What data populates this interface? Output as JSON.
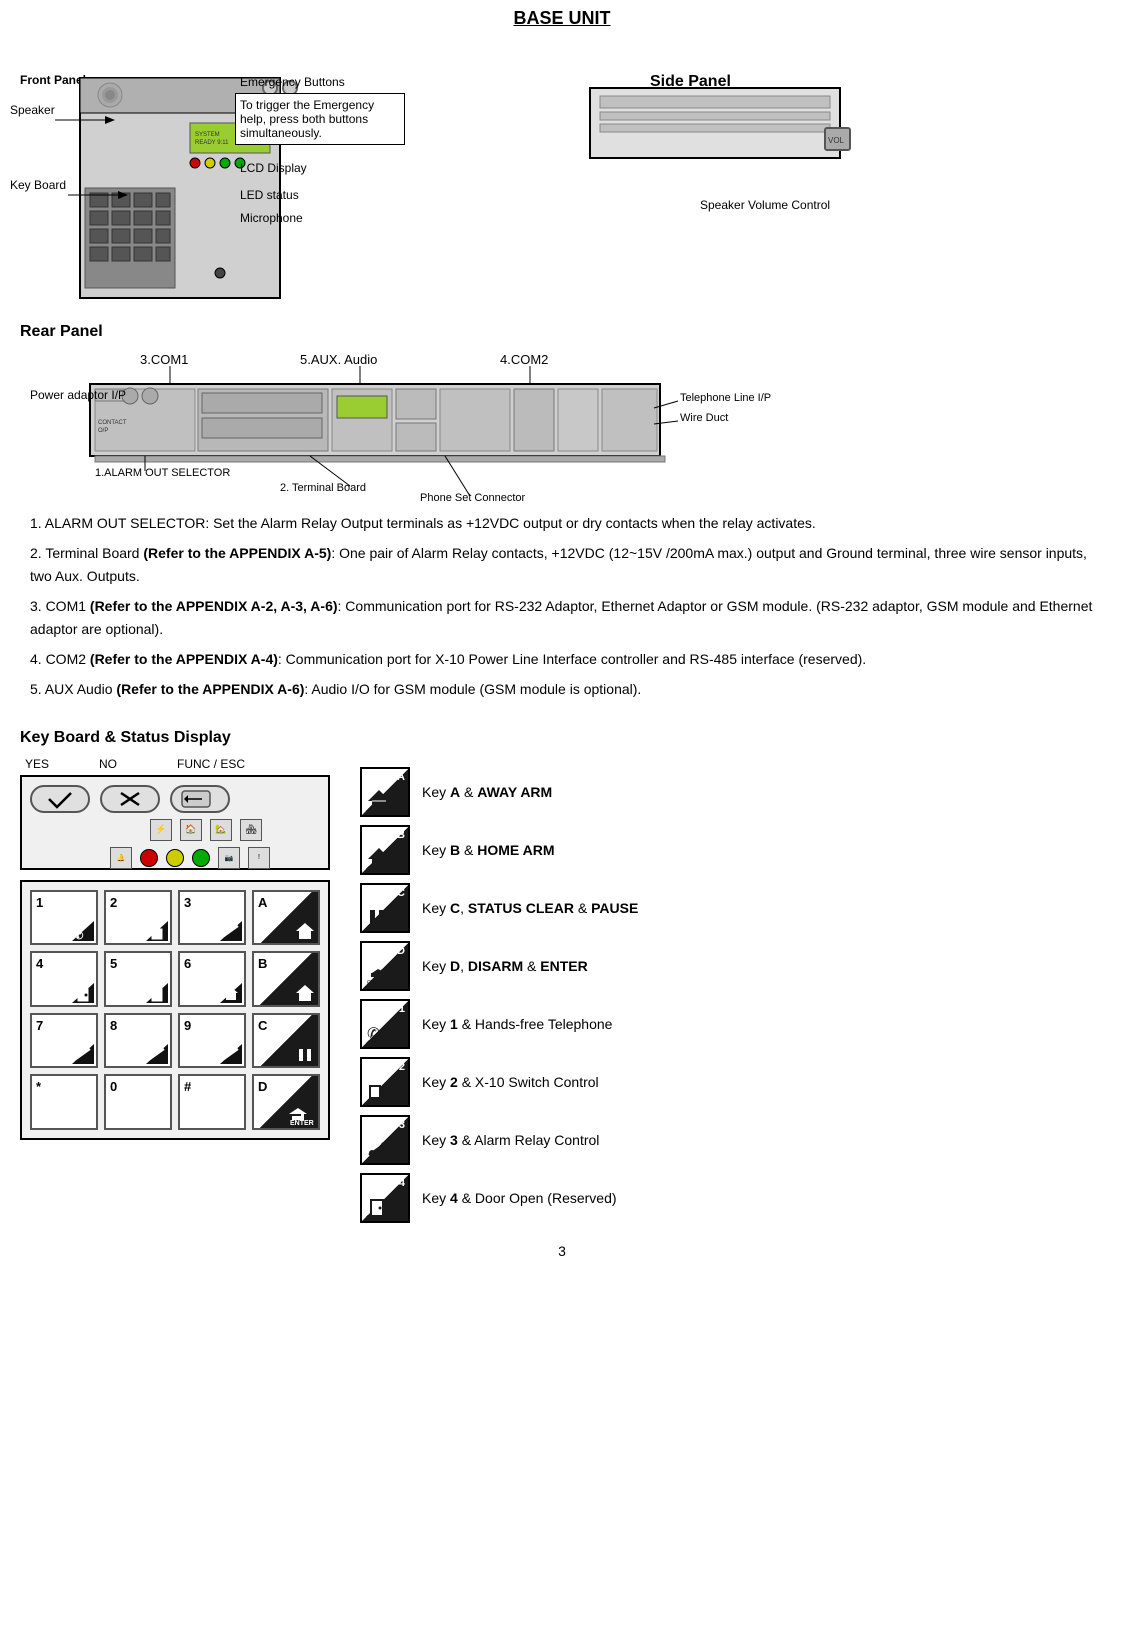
{
  "title": "BASE UNIT",
  "front_panel": {
    "label": "Front Panel",
    "side_panel_label": "Side Panel",
    "speaker_label": "Speaker",
    "key_board_label": "Key Board",
    "emergency_buttons_label": "Emergency Buttons",
    "emergency_desc": "To trigger the Emergency help, press both buttons simultaneously.",
    "lcd_label": "LCD Display",
    "led_label": "LED status",
    "mic_label": "Microphone",
    "speaker_volume_label": "Speaker Volume Control"
  },
  "rear_panel": {
    "label": "Rear Panel",
    "com1_label": "3.COM1",
    "aux_label": "5.AUX. Audio",
    "com2_label": "4.COM2",
    "alarm_label": "1.ALARM OUT SELECTOR",
    "terminal_label": "2. Terminal Board",
    "phone_connector_label": "Phone Set Connector",
    "telephone_label": "Telephone Line I/P",
    "wire_duct_label": "Wire Duct",
    "power_label": "Power adaptor I/P"
  },
  "descriptions": [
    {
      "id": 1,
      "text": "ALARM OUT SELECTOR: Set the Alarm Relay Output terminals as +12VDC output or dry contacts when the relay activates."
    },
    {
      "id": 2,
      "text": "Terminal Board ",
      "bold": "(Refer to the APPENDIX A-5)",
      "rest": ": One pair of Alarm Relay contacts, +12VDC (12~15V /200mA max.) output and Ground terminal, three wire sensor inputs, two Aux. Outputs."
    },
    {
      "id": 3,
      "text": "COM1 ",
      "bold": "(Refer to the APPENDIX A-2, A-3, A-6)",
      "rest": ": Communication port for RS-232 Adaptor, Ethernet Adaptor or GSM module. (RS-232 adaptor, GSM module and Ethernet adaptor are optional)."
    },
    {
      "id": 4,
      "text": "COM2 ",
      "bold": "(Refer to the APPENDIX A-4)",
      "rest": ": Communication port for X-10 Power Line Interface controller and RS-485 interface (reserved)."
    },
    {
      "id": 5,
      "text": "AUX Audio ",
      "bold": "(Refer to the APPENDIX A-6)",
      "rest": ": Audio I/O for GSM module (GSM module is optional)."
    }
  ],
  "keyboard_section": {
    "title": "Key Board & Status Display",
    "yes_label": "YES",
    "no_label": "NO",
    "func_esc_label": "FUNC / ESC",
    "keys": [
      {
        "num": "1",
        "symbol": "phone"
      },
      {
        "num": "2",
        "symbol": "box"
      },
      {
        "num": "3",
        "symbol": "slash"
      },
      {
        "num": "A",
        "symbol": "house-arm"
      },
      {
        "num": "4",
        "symbol": "box-key"
      },
      {
        "num": "5",
        "symbol": "box-key"
      },
      {
        "num": "6",
        "symbol": "house"
      },
      {
        "num": "B",
        "symbol": "home"
      },
      {
        "num": "7",
        "symbol": "slash"
      },
      {
        "num": "8",
        "symbol": "slash"
      },
      {
        "num": "9",
        "symbol": "slash"
      },
      {
        "num": "C",
        "symbol": "pause"
      },
      {
        "num": "*",
        "symbol": ""
      },
      {
        "num": "0",
        "symbol": ""
      },
      {
        "num": "#",
        "symbol": ""
      },
      {
        "num": "D",
        "symbol": "enter"
      }
    ],
    "key_descriptions": [
      {
        "letter": "A",
        "symbol": "house-away",
        "text": "Key ",
        "bold": "A",
        "rest": " & ",
        "bold2": "AWAY ARM"
      },
      {
        "letter": "B",
        "symbol": "house-home",
        "text": "Key ",
        "bold": "B",
        "rest": " & ",
        "bold2": "HOME ARM"
      },
      {
        "letter": "C",
        "symbol": "pause-c",
        "text": "Key ",
        "bold": "C",
        "rest": ", ",
        "bold2": "STATUS CLEAR",
        "rest2": " & ",
        "bold3": "PAUSE"
      },
      {
        "letter": "D",
        "symbol": "enter-d",
        "text": "Key ",
        "bold": "D",
        "rest": ", ",
        "bold2": "DISARM",
        "rest2": " & ",
        "bold3": "ENTER"
      },
      {
        "letter": "1",
        "symbol": "phone-1",
        "text": "Key ",
        "bold": "1",
        "rest": " & Hands-free Telephone"
      },
      {
        "letter": "2",
        "symbol": "x10-2",
        "text": "Key ",
        "bold": "2",
        "rest": " & X-10 Switch Control"
      },
      {
        "letter": "3",
        "symbol": "relay-3",
        "text": "Key ",
        "bold": "3",
        "rest": " & Alarm Relay Control"
      },
      {
        "letter": "4",
        "symbol": "door-4",
        "text": "Key ",
        "bold": "4",
        "rest": " & Door Open (Reserved)"
      }
    ]
  },
  "page_number": "3"
}
